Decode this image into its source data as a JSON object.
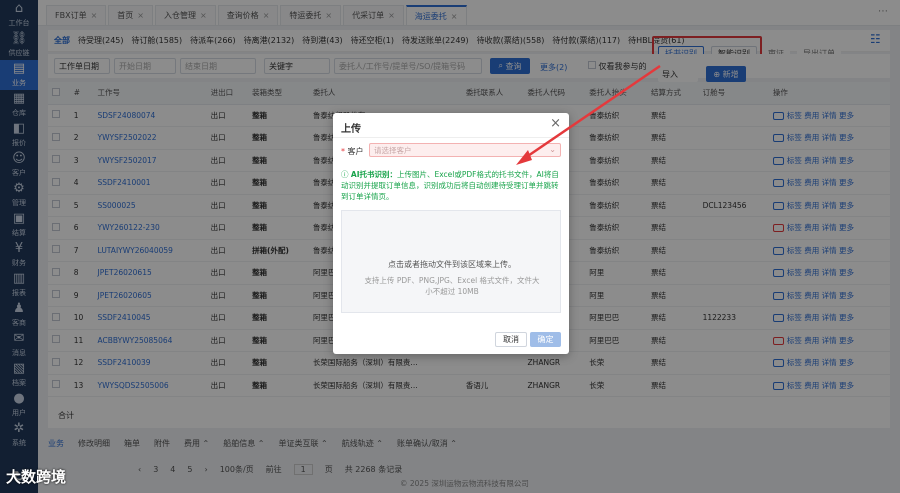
{
  "sidebar": {
    "items": [
      {
        "label": "工作台",
        "icon": "home-icon"
      },
      {
        "label": "供应链",
        "icon": "chain-icon"
      },
      {
        "label": "业务",
        "icon": "business-icon"
      },
      {
        "label": "仓库",
        "icon": "warehouse-icon"
      },
      {
        "label": "报价",
        "icon": "quote-icon"
      },
      {
        "label": "客户",
        "icon": "customer-icon"
      },
      {
        "label": "管理",
        "icon": "manage-icon"
      },
      {
        "label": "结算",
        "icon": "settle-icon"
      },
      {
        "label": "财务",
        "icon": "finance-icon"
      },
      {
        "label": "报表",
        "icon": "report-icon"
      },
      {
        "label": "客商",
        "icon": "merchant-icon"
      },
      {
        "label": "消息",
        "icon": "message-icon"
      },
      {
        "label": "档案",
        "icon": "archive-icon"
      },
      {
        "label": "用户",
        "icon": "user-icon"
      },
      {
        "label": "系统",
        "icon": "gear-icon"
      }
    ],
    "active_index": 2
  },
  "tabs": [
    {
      "label": "FBX订单"
    },
    {
      "label": "首页"
    },
    {
      "label": "入仓管理"
    },
    {
      "label": "查询价格"
    },
    {
      "label": "特运委托"
    },
    {
      "label": "代采订单"
    },
    {
      "label": "海运委托"
    }
  ],
  "active_tab": 6,
  "status_tabs": [
    {
      "label": "全部"
    },
    {
      "label": "待受理(245)"
    },
    {
      "label": "待订舱(1585)"
    },
    {
      "label": "待派车(266)"
    },
    {
      "label": "待离港(2132)"
    },
    {
      "label": "待到港(43)"
    },
    {
      "label": "待还空柜(1)"
    },
    {
      "label": "待发送账单(2249)"
    },
    {
      "label": "待收款(票结)(558)"
    },
    {
      "label": "待付款(票结)(117)"
    },
    {
      "label": "待HBL提货(61)"
    }
  ],
  "actions": {
    "tuoshu": "托书识别",
    "zhineng": "智能识别",
    "shenzheng": "审证",
    "export": "导出订单",
    "import": "导入",
    "add": "新增"
  },
  "filters": {
    "date_type": "工作单日期",
    "start_date": "开始日期",
    "end_date": "结束日期",
    "keyword": "关键字",
    "keyword_placeholder": "委托人/工作号/提单号/SO/提箱号码",
    "query": "查询",
    "more": "更多(2)",
    "only_mine": "仅看我参与的"
  },
  "table": {
    "columns": [
      "",
      "#",
      "工作号",
      "进出口",
      "装箱类型",
      "委托人",
      "委托联系人",
      "委托人代码",
      "委托人抬头",
      "结算方式",
      "订舱号",
      "操作"
    ],
    "rows": [
      {
        "no": "1",
        "job": "SDSF24080074",
        "io": "出口",
        "pack": "整箱",
        "client": "鲁泰纺织股份有",
        "contact": "",
        "code": "",
        "head": "鲁泰纺织",
        "settle": "票结",
        "booking": "",
        "msg": "blue"
      },
      {
        "no": "2",
        "job": "YWYSF2502022",
        "io": "出口",
        "pack": "整箱",
        "client": "鲁泰纺织股份有",
        "contact": "",
        "code": "",
        "head": "鲁泰纺织",
        "settle": "票结",
        "booking": "",
        "msg": "blue"
      },
      {
        "no": "3",
        "job": "YWYSF2502017",
        "io": "出口",
        "pack": "整箱",
        "client": "鲁泰纺织股份有",
        "contact": "",
        "code": "",
        "head": "鲁泰纺织",
        "settle": "票结",
        "booking": "",
        "msg": "blue"
      },
      {
        "no": "4",
        "job": "SSDF2410001",
        "io": "出口",
        "pack": "整箱",
        "client": "鲁泰纺织股份有",
        "contact": "",
        "code": "",
        "head": "鲁泰纺织",
        "settle": "票结",
        "booking": "",
        "msg": "blue"
      },
      {
        "no": "5",
        "job": "SS000025",
        "io": "出口",
        "pack": "整箱",
        "client": "鲁泰纺织股份有",
        "contact": "",
        "code": "",
        "head": "鲁泰纺织",
        "settle": "票结",
        "booking": "DCL123456",
        "msg": "blue"
      },
      {
        "no": "6",
        "job": "YWY260122-230",
        "io": "出口",
        "pack": "整箱",
        "client": "鲁泰纺织股份有",
        "contact": "",
        "code": "",
        "head": "鲁泰纺织",
        "settle": "票结",
        "booking": "",
        "msg": "red"
      },
      {
        "no": "7",
        "job": "LUTAIYWY26040059",
        "io": "出口",
        "pack": "拼箱(外配)",
        "client": "鲁泰纺织股份有",
        "contact": "",
        "code": "",
        "head": "鲁泰纺织",
        "settle": "票结",
        "booking": "",
        "msg": "blue"
      },
      {
        "no": "8",
        "job": "JPET26020615",
        "io": "出口",
        "pack": "整箱",
        "client": "阿里巴巴集团",
        "contact": "",
        "code": "",
        "head": "阿里",
        "settle": "票结",
        "booking": "",
        "msg": "blue"
      },
      {
        "no": "9",
        "job": "JPET26020605",
        "io": "出口",
        "pack": "整箱",
        "client": "阿里巴巴集团",
        "contact": "",
        "code": "",
        "head": "阿里",
        "settle": "票结",
        "booking": "",
        "msg": "blue"
      },
      {
        "no": "10",
        "job": "SSDF2410045",
        "io": "出口",
        "pack": "整箱",
        "client": "阿里巴巴有限公",
        "contact": "",
        "code": "",
        "head": "阿里巴巴",
        "settle": "票结",
        "booking": "1122233",
        "msg": "blue"
      },
      {
        "no": "11",
        "job": "ACBBYWY25085064",
        "io": "出口",
        "pack": "整箱",
        "client": "阿里巴巴有限公",
        "contact": "",
        "code": "",
        "head": "阿里巴巴",
        "settle": "票结",
        "booking": "",
        "msg": "red"
      },
      {
        "no": "12",
        "job": "SSDF2410039",
        "io": "出口",
        "pack": "整箱",
        "client": "长荣国际船务（深圳）有限责...",
        "contact": "",
        "code": "ZHANGR",
        "head": "长荣",
        "settle": "票结",
        "booking": "",
        "msg": "blue"
      },
      {
        "no": "13",
        "job": "YWYSQDS2505006",
        "io": "出口",
        "pack": "整箱",
        "client": "长荣国际船务（深圳）有限责...",
        "contact": "香语儿",
        "code": "ZHANGR",
        "head": "长荣",
        "settle": "票结",
        "booking": "",
        "msg": "blue"
      }
    ],
    "ops_label": "标签 费用 详情 更多",
    "sum_label": "合计"
  },
  "bottom_tabs": [
    "业务",
    "修改明细",
    "箱单",
    "附件",
    "费用",
    "船舶信息",
    "单证类互联",
    "航线轨迹",
    "账单确认/取消"
  ],
  "pager": {
    "pages": [
      "3",
      "4",
      "5"
    ],
    "page_size": "100条/页",
    "goto_label": "前往",
    "goto_value": "1",
    "page_suffix": "页",
    "total": "共 2268 条记录"
  },
  "copyright": "© 2025 深圳运物云物流科技有限公司",
  "watermark": "大数跨境",
  "modal": {
    "title": "上传",
    "customer_label": "客户",
    "customer_placeholder": "请选择客户",
    "ai_tip_title": "AI托书识别：",
    "ai_tip_body": "上传图片、Excel或PDF格式的托书文件，AI将自动识别并提取订单信息，识别成功后将自动创建待受理订单并跳转到订单详情页。",
    "drop_main": "点击或者拖动文件到该区域来上传。",
    "drop_sub": "支持上传 PDF、PNG,JPG、Excel 格式文件，文件大小不超过 10MB",
    "cancel": "取消",
    "ok": "确定"
  },
  "colors": {
    "primary": "#2f6fd6",
    "sidebar": "#213a5c",
    "highlight": "#e4393c",
    "tip_green": "#17a34a"
  }
}
